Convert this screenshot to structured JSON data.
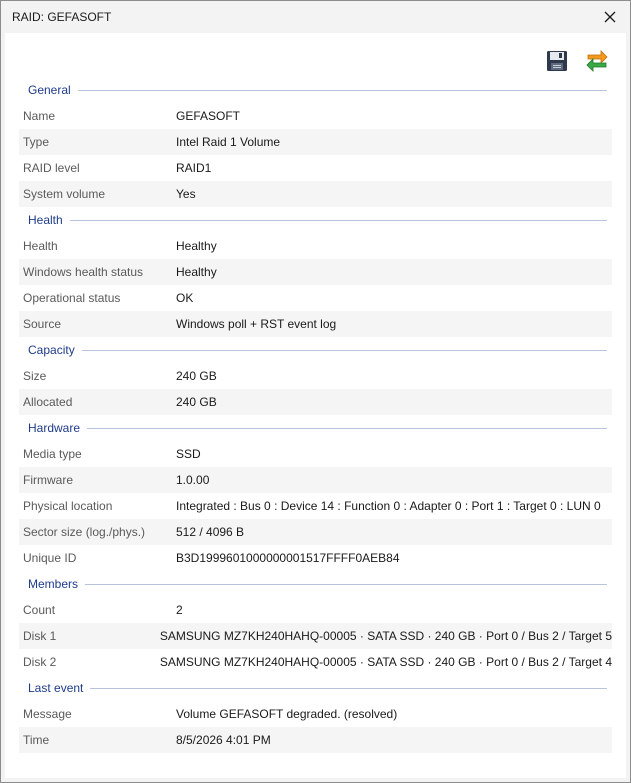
{
  "window": {
    "title": "RAID: GEFASOFT"
  },
  "icons": {
    "close": "close-icon",
    "save": "save-icon",
    "refresh": "refresh-icon"
  },
  "sections": [
    {
      "title": "General",
      "rows": [
        {
          "label": "Name",
          "value": "GEFASOFT"
        },
        {
          "label": "Type",
          "value": "Intel Raid 1 Volume"
        },
        {
          "label": "RAID level",
          "value": "RAID1"
        },
        {
          "label": "System volume",
          "value": "Yes"
        }
      ]
    },
    {
      "title": "Health",
      "rows": [
        {
          "label": "Health",
          "value": "Healthy"
        },
        {
          "label": "Windows health status",
          "value": "Healthy"
        },
        {
          "label": "Operational status",
          "value": "OK"
        },
        {
          "label": "Source",
          "value": "Windows poll + RST event log"
        }
      ]
    },
    {
      "title": "Capacity",
      "rows": [
        {
          "label": "Size",
          "value": "240 GB"
        },
        {
          "label": "Allocated",
          "value": "240 GB"
        }
      ]
    },
    {
      "title": "Hardware",
      "rows": [
        {
          "label": "Media type",
          "value": "SSD"
        },
        {
          "label": "Firmware",
          "value": "1.0.00"
        },
        {
          "label": "Physical location",
          "value": "Integrated : Bus 0 : Device 14 : Function 0 : Adapter 0 : Port 1 : Target 0 : LUN 0"
        },
        {
          "label": "Sector size (log./phys.)",
          "value": "512 / 4096 B"
        },
        {
          "label": "Unique ID",
          "value": "B3D1999601000000001517FFFF0AEB84"
        }
      ]
    },
    {
      "title": "Members",
      "rows": [
        {
          "label": "Count",
          "value": "2"
        },
        {
          "label": "Disk 1",
          "value": "SAMSUNG MZ7KH240HAHQ-00005 · SATA SSD · 240 GB · Port 0 / Bus 2 / Target 5"
        },
        {
          "label": "Disk 2",
          "value": "SAMSUNG MZ7KH240HAHQ-00005 · SATA SSD · 240 GB · Port 0 / Bus 2 / Target 4"
        }
      ]
    },
    {
      "title": "Last event",
      "rows": [
        {
          "label": "Message",
          "value": "Volume GEFASOFT degraded. (resolved)"
        },
        {
          "label": "Time",
          "value": "8/5/2026 4:01 PM"
        }
      ]
    }
  ],
  "colors": {
    "section_title": "#1f3c8a",
    "section_line": "#b8c4dc",
    "alt_row": "#f5f5f5"
  }
}
